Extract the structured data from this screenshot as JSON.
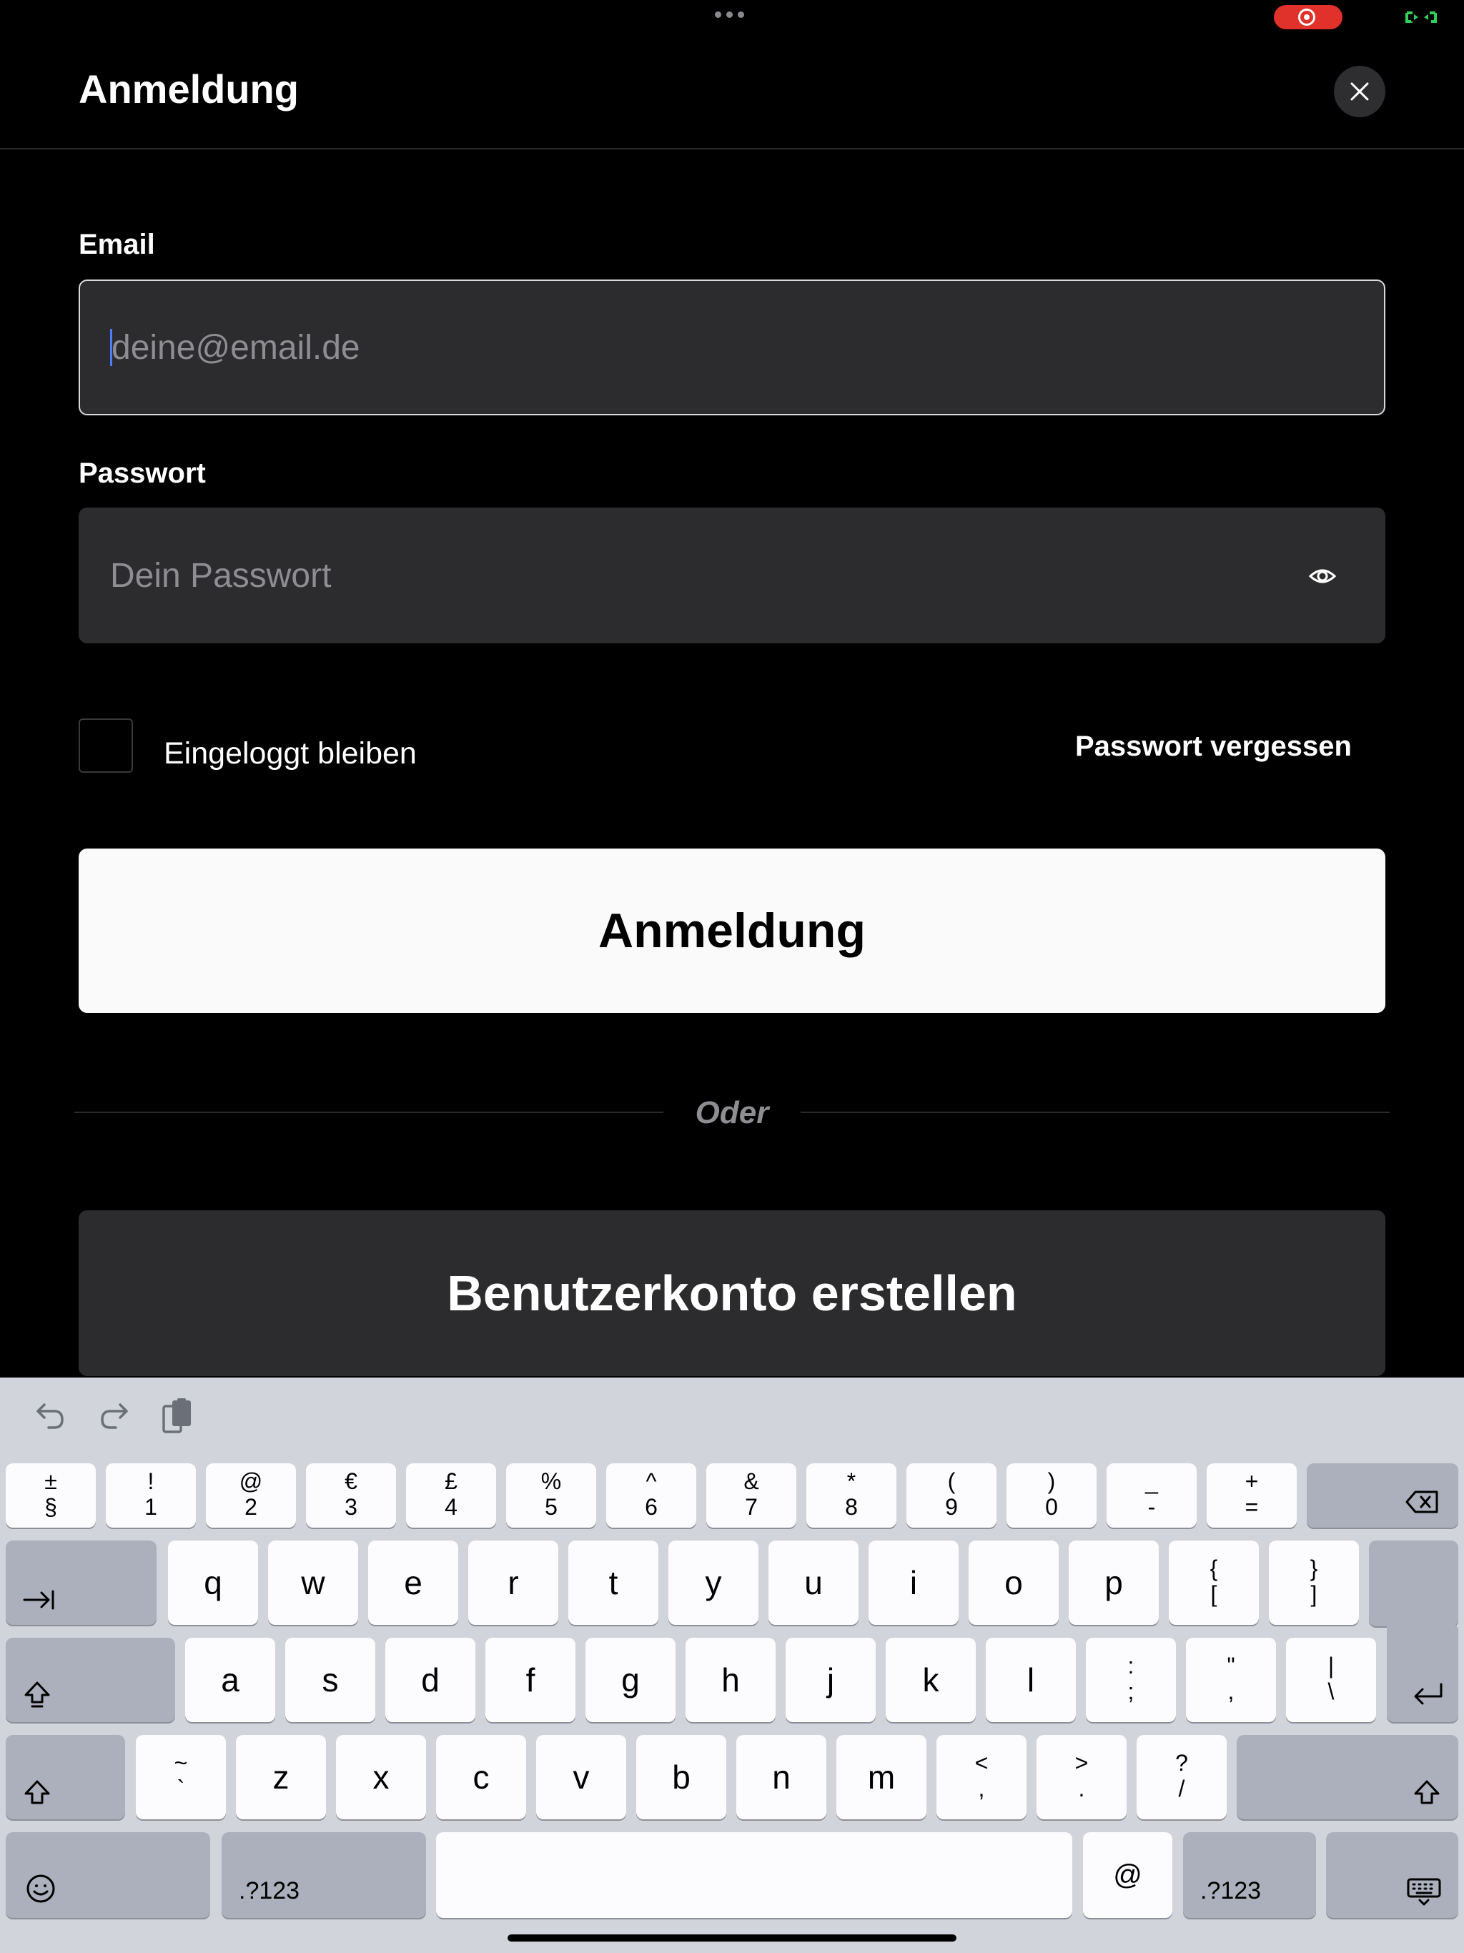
{
  "header": {
    "title": "Anmeldung"
  },
  "form": {
    "email_label": "Email",
    "email_placeholder": "deine@email.de",
    "email_value": "",
    "password_label": "Passwort",
    "password_placeholder": "Dein Passwort",
    "password_value": "",
    "remember_label": "Eingeloggt bleiben",
    "remember_checked": false,
    "forgot_label": "Passwort vergessen",
    "login_button": "Anmeldung",
    "divider_text": "Oder",
    "create_account_button": "Benutzerkonto erstellen"
  },
  "colors": {
    "background": "#000000",
    "field": "#2c2c2e",
    "primary_button": "#fafafa",
    "recording": "#e0312b"
  },
  "keyboard": {
    "number_row": [
      {
        "top": "±",
        "bottom": "§"
      },
      {
        "top": "!",
        "bottom": "1"
      },
      {
        "top": "@",
        "bottom": "2"
      },
      {
        "top": "€",
        "bottom": "3"
      },
      {
        "top": "£",
        "bottom": "4"
      },
      {
        "top": "%",
        "bottom": "5"
      },
      {
        "top": "^",
        "bottom": "6"
      },
      {
        "top": "&",
        "bottom": "7"
      },
      {
        "top": "*",
        "bottom": "8"
      },
      {
        "top": "(",
        "bottom": "9"
      },
      {
        "top": ")",
        "bottom": "0"
      },
      {
        "top": "_",
        "bottom": "-"
      },
      {
        "top": "+",
        "bottom": "="
      }
    ],
    "row_q": [
      "q",
      "w",
      "e",
      "r",
      "t",
      "y",
      "u",
      "i",
      "o",
      "p"
    ],
    "row_q_extra": [
      {
        "top": "{",
        "bottom": "["
      },
      {
        "top": "}",
        "bottom": "]"
      }
    ],
    "row_a": [
      "a",
      "s",
      "d",
      "f",
      "g",
      "h",
      "j",
      "k",
      "l"
    ],
    "row_a_extra": [
      {
        "top": ":",
        "bottom": ";"
      },
      {
        "top": "\"",
        "bottom": ","
      },
      {
        "top": "|",
        "bottom": "\\"
      }
    ],
    "row_z_lead": {
      "top": "~",
      "bottom": "`"
    },
    "row_z": [
      "z",
      "x",
      "c",
      "v",
      "b",
      "n",
      "m"
    ],
    "row_z_extra": [
      {
        "top": "<",
        "bottom": ","
      },
      {
        "top": ">",
        "bottom": "."
      },
      {
        "top": "?",
        "bottom": "/"
      }
    ],
    "numbers_label": ".?123",
    "at_key": "@"
  }
}
